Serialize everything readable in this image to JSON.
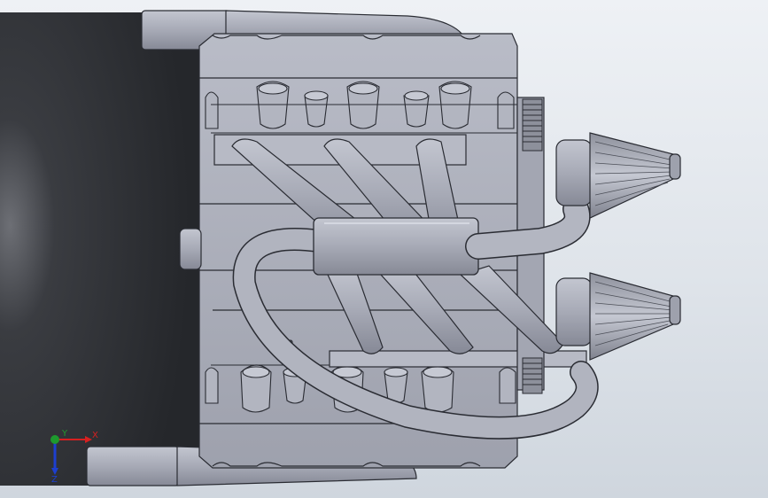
{
  "viewport": {
    "background_top": "#eef1f5",
    "background_bottom": "#cfd6de"
  },
  "model": {
    "body_color": "#a9acb8",
    "shadow_color": "#26282c",
    "outline_color": "#2a2c33"
  },
  "triad": {
    "x_label": "X",
    "y_label": "Y",
    "z_label": "Z",
    "x_color": "#d62020",
    "y_color": "#1e9a2e",
    "z_color": "#1d3fcf"
  }
}
